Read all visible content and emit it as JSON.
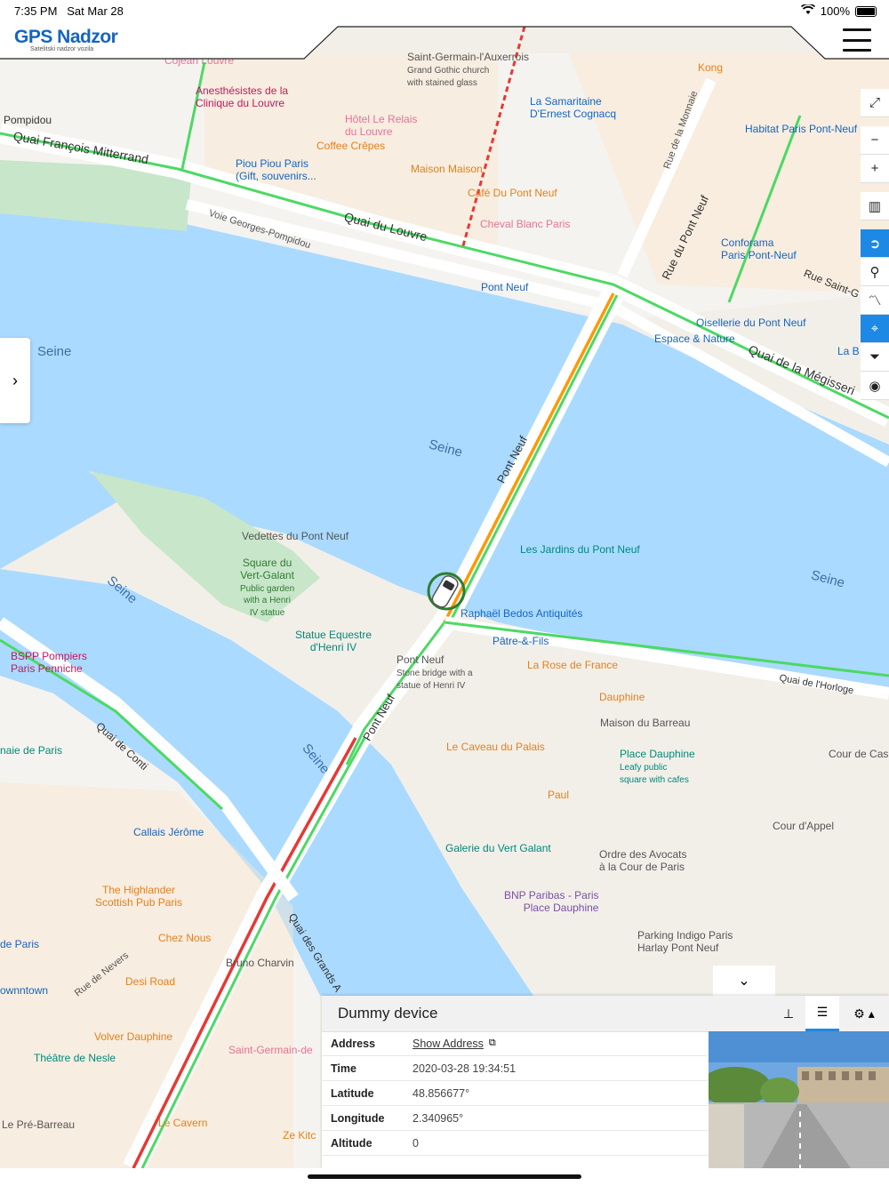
{
  "status_bar": {
    "time": "7:35 PM",
    "date": "Sat Mar 28",
    "battery": "100%"
  },
  "header": {
    "brand": "GPS Nadzor",
    "subtitle": "Satelitski nadzor vozila"
  },
  "map": {
    "labels": [
      "Saint-Germain-l'Auxerrois",
      "Grand Gothic church",
      "with stained glass",
      "Anesthésistes de la",
      "Clinique du Louvre",
      "Hôtel Le Relais",
      "du Louvre",
      "Coffee Crêpes",
      "Piou Piou Paris",
      "(Gift, souvenirs...",
      "Maison Maison",
      "Café Du Pont Neuf",
      "Cheval Blanc Paris",
      "La Samaritaine",
      "D'Ernest Cognacq",
      "Kong",
      "Habitat Paris Pont-Neuf",
      "Conforama",
      "Paris Pont-Neuf",
      "Oisellerie du Pont Neuf",
      "Espace & Nature",
      "La B",
      "Pont Neuf",
      "Quai François Mitterrand",
      "Pompidou",
      "Quai du Louvre",
      "Voie Georges-Pompidou",
      "Rue de la Monnaie",
      "Rue du Pont Neuf",
      "Rue Saint-G",
      "Quai de la Mégisseri",
      "Seine",
      "Pont Neuf",
      "Vedettes du Pont Neuf",
      "Square du",
      "Vert-Galant",
      "Public garden",
      "with a Henri",
      "IV statue",
      "Statue Equestre",
      "d'Henri IV",
      "Les Jardins du Pont Neuf",
      "Raphaël Bedos Antiquités",
      "Pâtre-&-Fils",
      "La Rose de France",
      "Dauphine",
      "Stone bridge with a",
      "statue of Henri IV",
      "Quai de l'Horloge",
      "Maison du Barreau",
      "Le Caveau du Palais",
      "Place Dauphine",
      "Leafy public",
      "square with cafes",
      "Cour de Cas",
      "Paul",
      "Cour d'Appel",
      "Galerie du Vert Galant",
      "Ordre des Avocats",
      "à la Cour de Paris",
      "BNP Paribas - Paris",
      "Place Dauphine",
      "Parking Indigo Paris",
      "Harlay Pont Neuf",
      "BSPP Pompiers",
      "Paris Penniche",
      "naie de Paris",
      "Quai de Conti",
      "Callais Jérôme",
      "The Highlander",
      "Scottish Pub Paris",
      "Chez Nous",
      "Bruno Charvin",
      "Quai des Grands A",
      "Desi Road",
      "Rue de Nevers",
      "de Paris",
      "ownntown",
      "Volver Dauphine",
      "Théâtre de Nesle",
      "Saint-Germain-de",
      "Le Pré-Barreau",
      "Le Cavern",
      "Ze Kitc",
      "Rue de Nevers",
      "Cojean Louvre"
    ]
  },
  "device": {
    "name": "Dummy device",
    "fields": [
      {
        "label": "Address",
        "value": "Show Address"
      },
      {
        "label": "Time",
        "value": "2020-03-28 19:34:51"
      },
      {
        "label": "Latitude",
        "value": "48.856677°"
      },
      {
        "label": "Longitude",
        "value": "2.340965°"
      },
      {
        "label": "Altitude",
        "value": "0"
      }
    ]
  },
  "colors": {
    "accent": "#1e88e5",
    "water": "#aadaff",
    "road_green": "#4cd964",
    "road_red": "#e53935",
    "road_orange": "#ff9800"
  }
}
